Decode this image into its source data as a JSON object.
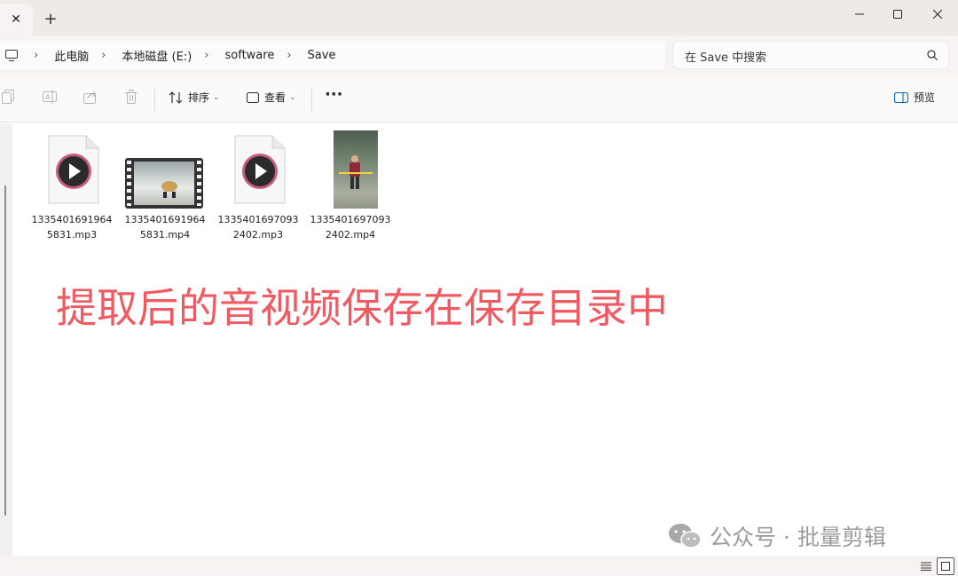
{
  "titlebar": {
    "close_tab_glyph": "✕",
    "new_tab_glyph": "+",
    "controls": [
      "minimize-icon",
      "maximize-icon",
      "close-icon"
    ]
  },
  "address": {
    "root_icon": "pc-icon",
    "breadcrumbs": [
      "此电脑",
      "本地磁盘 (E:)",
      "software",
      "Save"
    ],
    "separator": "›"
  },
  "search": {
    "placeholder": "在 Save 中搜索",
    "icon": "search-icon"
  },
  "toolbar": {
    "actions": [
      "copy-icon",
      "rename-icon",
      "share-icon",
      "delete-icon"
    ],
    "sort_label": "排序",
    "view_label": "查看",
    "more_glyph": "···",
    "preview_label": "预览",
    "chevron": "⌄"
  },
  "files": [
    {
      "name": "13354016919645831.mp3",
      "type": "mp3"
    },
    {
      "name": "13354016919645831.mp4",
      "type": "mp4-landscape"
    },
    {
      "name": "13354016970932402.mp3",
      "type": "mp3"
    },
    {
      "name": "13354016970932402.mp4",
      "type": "mp4-portrait"
    }
  ],
  "annotation": "提取后的音视频保存在保存目录中",
  "watermark": "公众号 · 批量剪辑",
  "colors": {
    "annotation": "#f05a62",
    "accent": "#0067c0",
    "titlebar": "#eeeae8"
  }
}
